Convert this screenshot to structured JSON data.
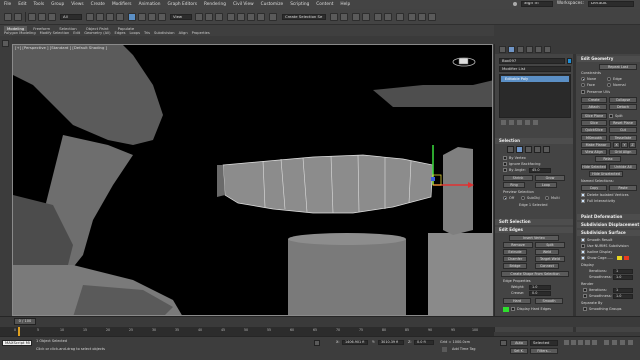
{
  "menu": {
    "items": [
      "File",
      "Edit",
      "Tools",
      "Group",
      "Views",
      "Create",
      "Modifiers",
      "Animation",
      "Graph Editors",
      "Rendering",
      "Civil View",
      "Customize",
      "Scripting",
      "Content",
      "Help"
    ],
    "signin": "Sign In",
    "workspaces_label": "Workspaces:",
    "workspace_value": "Default"
  },
  "toolbar": {
    "filter_value": "All",
    "view_value": "View",
    "selection_set_placeholder": "Create Selection Se"
  },
  "ribbon": {
    "tabs": [
      "Modeling",
      "Freeform",
      "Selection",
      "Object Paint",
      "Populate"
    ],
    "subtabs": [
      "Polygon Modeling",
      "Modify Selection",
      "Edit",
      "Geometry (All)",
      "Edges",
      "Loops",
      "Tris",
      "Subdivision",
      "Align",
      "Properties"
    ]
  },
  "viewport": {
    "label": "[+] [Perspective ] [Standard ] [Default Shading ]"
  },
  "command_panel": {
    "object_name": "Box097",
    "modifier_list": "Modifier List",
    "stack_item": "Editable Poly",
    "selection_title": "Selection",
    "by_vertex": "By Vertex",
    "ignore_backfacing": "Ignore Backfacing",
    "by_angle": "By Angle:",
    "by_angle_value": "45.0",
    "shrink": "Shrink",
    "grow": "Grow",
    "ring": "Ring",
    "loop": "Loop",
    "preview_selection": "Preview Selection",
    "preview_off": "Off",
    "preview_subobj": "SubObj",
    "preview_multi": "Multi",
    "edge_selected": "Edge 1 Selected",
    "soft_selection": "Soft Selection",
    "edit_edges": "Edit Edges",
    "insert_vertex": "Insert Vertex",
    "remove": "Remove",
    "split": "Split",
    "extrude": "Extrude",
    "weld": "Weld",
    "chamfer": "Chamfer",
    "target_weld": "Target Weld",
    "bridge": "Bridge",
    "connect": "Connect",
    "create_shape": "Create Shape From Selection",
    "edge_properties": "Edge Properties",
    "weight_label": "Weight:",
    "weight_value": "1.0",
    "crease_label": "Crease:",
    "crease_value": "0.0",
    "hard": "Hard",
    "smooth": "Smooth",
    "display_hard_edges": "Display Hard Edges"
  },
  "edit_geometry": {
    "title": "Edit Geometry",
    "repeat_last": "Repeat Last",
    "constraints": "Constraints",
    "none": "None",
    "edge": "Edge",
    "face": "Face",
    "normal": "Normal",
    "preserve_uvs": "Preserve UVs",
    "create": "Create",
    "collapse": "Collapse",
    "attach": "Attach",
    "detach": "Detach",
    "slice_plane": "Slice Plane",
    "split": "Split",
    "slice": "Slice",
    "reset_plane": "Reset Plane",
    "quickslice": "QuickSlice",
    "cut": "Cut",
    "msmooth": "MSmooth",
    "tessellate": "Tessellate",
    "make_planar": "Make Planar",
    "x": "X",
    "y": "Y",
    "z": "Z",
    "view_align": "View Align",
    "grid_align": "Grid Align",
    "relax": "Relax",
    "hide_selected": "Hide Selected",
    "unhide_all": "Unhide All",
    "hide_unselected": "Hide Unselected",
    "named_selections": "Named Selections:",
    "copy": "Copy",
    "paste": "Paste",
    "delete_isolated": "Delete Isolated Vertices",
    "full_interactivity": "Full Interactivity",
    "paint_deformation": "Paint Deformation",
    "subdivision_displacement": "Subdivision Displacement",
    "subdivision_surface": "Subdivision Surface",
    "smooth_result": "Smooth Result",
    "use_nurms": "Use NURMS Subdivision",
    "isoline_display": "Isoline Display",
    "show_cage": "Show Cage......",
    "display": "Display",
    "iterations": "Iterations:",
    "iterations_value": "1",
    "smoothness": "Smoothness:",
    "smoothness_value": "1.0",
    "render": "Render",
    "separate_by": "Separate By",
    "smoothing_groups": "Smoothing Groups"
  },
  "timeline": {
    "frame": "0 / 100",
    "ticks": [
      "0",
      "5",
      "10",
      "15",
      "20",
      "25",
      "30",
      "35",
      "40",
      "45",
      "50",
      "55",
      "60",
      "65",
      "70",
      "75",
      "80",
      "85",
      "90",
      "95",
      "100"
    ]
  },
  "status": {
    "script_label": "MAXScript Mi",
    "selected": "1 Object Selected",
    "hint": "Click or click-and-drag to select objects",
    "x_label": "X:",
    "x_value": "1406.901 fi",
    "y_label": "Y:",
    "y_value": "3010.39 fi",
    "z_label": "Z:",
    "z_value": "0.0 fi",
    "grid": "Grid = 1000.0cm",
    "add_time_tag": "Add Time Tag",
    "auto": "Auto",
    "selected_dropdown": "Selected",
    "set_k": "Set K.",
    "filters": "Filters..."
  }
}
